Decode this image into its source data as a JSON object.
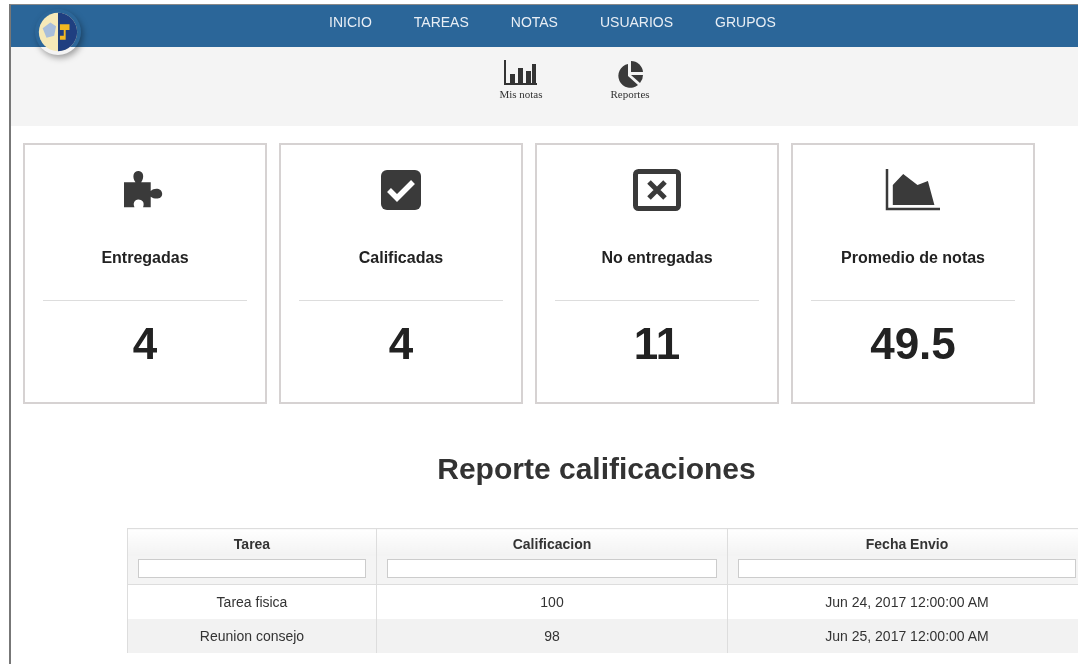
{
  "nav": {
    "items": [
      {
        "label": "INICIO"
      },
      {
        "label": "TAREAS"
      },
      {
        "label": "NOTAS"
      },
      {
        "label": "USUARIOS"
      },
      {
        "label": "GRUPOS"
      }
    ]
  },
  "sub_nav": {
    "items": [
      {
        "label": "Mis notas",
        "kind": "bars"
      },
      {
        "label": "Reportes",
        "kind": "pie"
      }
    ]
  },
  "stats": [
    {
      "label": "Entregadas",
      "value": "4",
      "kind": "puzzle"
    },
    {
      "label": "Calificadas",
      "value": "4",
      "kind": "check"
    },
    {
      "label": "No entregadas",
      "value": "11",
      "kind": "cross"
    },
    {
      "label": "Promedio de notas",
      "value": "49.5",
      "kind": "area"
    }
  ],
  "report": {
    "title": "Reporte calificaciones",
    "table": {
      "columns": [
        "Tarea",
        "Calificacion",
        "Fecha Envio"
      ],
      "rows": [
        [
          "Tarea fisica",
          "100",
          "Jun 24, 2017 12:00:00 AM"
        ],
        [
          "Reunion consejo",
          "98",
          "Jun 25, 2017 12:00:00 AM"
        ]
      ]
    }
  }
}
